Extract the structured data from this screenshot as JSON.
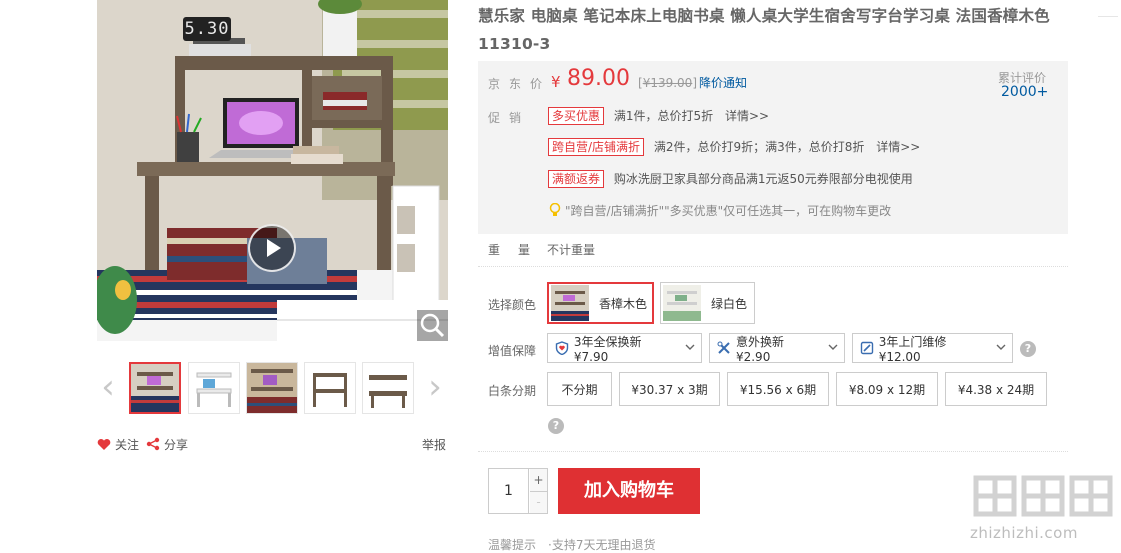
{
  "gallery": {
    "clock_text": "5.30",
    "thumbnails": [
      "desk-walnut-bed",
      "desk-white-room",
      "desk-walnut-study",
      "desk-walnut-frame",
      "desk-walnut-plain"
    ],
    "follow_label": "关注",
    "share_label": "分享",
    "report_label": "举报"
  },
  "product": {
    "title": "慧乐家 电脑桌 笔记本床上电脑书桌 懒人桌大学生宿舍写字台学习桌 法国香樟木色 11310-3"
  },
  "price": {
    "label": "京东价",
    "currency": "¥",
    "value": "89.00",
    "original_open": "[",
    "original": "¥139.00",
    "original_close": "]",
    "notice_link": "降价通知",
    "review_label": "累计评价",
    "review_count": "2000+"
  },
  "promotions": {
    "label": "促销",
    "items": [
      {
        "tag": "多买优惠",
        "text": "满1件，总价打5折",
        "link": "详情>>"
      },
      {
        "tag": "跨自营/店铺满折",
        "text": "满2件，总价打9折；满3件，总价打8折",
        "link": "详情>>"
      },
      {
        "tag": "满额返券",
        "text": "购冰洗厨卫家具部分商品满1元返50元券限部分电视使用",
        "link": ""
      }
    ],
    "tip": "\"跨自营/店铺满折\"\"多买优惠\"仅可任选其一，可在购物车更改"
  },
  "weight": {
    "label": "重量",
    "value": "不计重量"
  },
  "colors": {
    "label": "选择颜色",
    "options": [
      {
        "name": "香樟木色",
        "selected": true
      },
      {
        "name": "绿白色",
        "selected": false
      }
    ]
  },
  "services": {
    "label": "增值保障",
    "options": [
      {
        "name": "3年全保换新 ¥7.90",
        "icon": "shield-icon"
      },
      {
        "name": "意外换新 ¥2.90",
        "icon": "tools-icon"
      },
      {
        "name": "3年上门维修 ¥12.00",
        "icon": "repair-icon"
      }
    ],
    "help": "?"
  },
  "installments": {
    "label": "白条分期",
    "options": [
      "不分期",
      "¥30.37 x 3期",
      "¥15.56 x 6期",
      "¥8.09 x 12期",
      "¥4.38 x 24期"
    ],
    "help": "?"
  },
  "buy": {
    "quantity": "1",
    "plus": "+",
    "minus": "-",
    "cart_button": "加入购物车"
  },
  "kindly": {
    "label": "温馨提示",
    "text": "·支持7天无理由退货"
  },
  "watermark": {
    "text": "zhizhizhi.com"
  },
  "colors_theme": {
    "accent": "#e4393c",
    "link": "#005aa0",
    "button": "#df3033"
  }
}
